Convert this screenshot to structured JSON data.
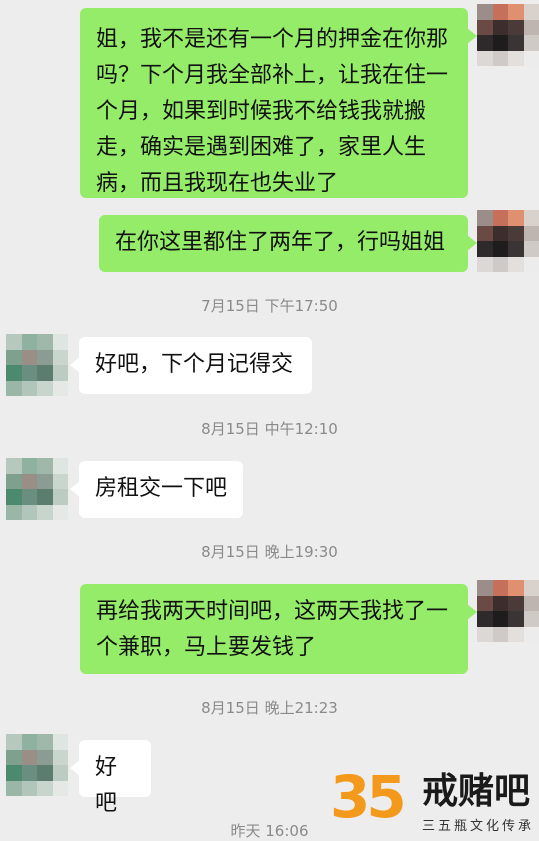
{
  "messages": [
    {
      "side": "right",
      "text": "姐，我不是还有一个月的押金在你那吗？下个月我全部补上，让我在住一个月，如果到时候我不给钱我就搬走，确实是遇到困难了，家里人生病，而且我现在也失业了"
    },
    {
      "side": "right",
      "text": "在你这里都住了两年了，行吗姐姐"
    },
    {
      "side": "time",
      "text": "7月15日 下午17:50"
    },
    {
      "side": "left",
      "text": "好吧，下个月记得交"
    },
    {
      "side": "time",
      "text": "8月15日 中午12:10"
    },
    {
      "side": "left",
      "text": "房租交一下吧"
    },
    {
      "side": "time",
      "text": "8月15日 晚上19:30"
    },
    {
      "side": "right",
      "text": "再给我两天时间吧，这两天我找了一个兼职，马上要发钱了"
    },
    {
      "side": "time",
      "text": "8月15日 晚上21:23"
    },
    {
      "side": "left",
      "text": "好吧"
    },
    {
      "side": "time",
      "text": "昨天 16:06"
    }
  ],
  "watermark": {
    "number": "35",
    "name": "戒赌吧",
    "tagline": "三五瓶文化传承"
  },
  "colors": {
    "background": "#ededed",
    "self_bubble": "#95ec69",
    "other_bubble": "#ffffff",
    "timestamp": "#8a8a8a",
    "logo_orange": "#f39a1d"
  }
}
